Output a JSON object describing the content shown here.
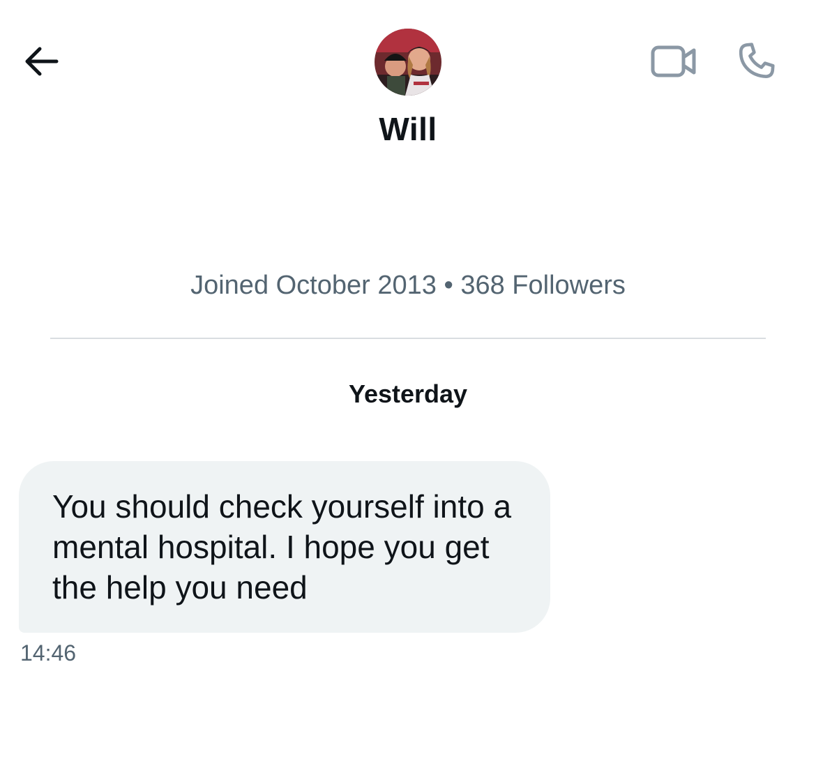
{
  "header": {
    "back_icon": "arrow-left-icon",
    "contact_name": "Will",
    "video_icon": "video-camera-icon",
    "call_icon": "phone-icon"
  },
  "profile": {
    "joined": "Joined October 2013",
    "separator": "•",
    "followers": "368 Followers"
  },
  "conversation": {
    "date_label": "Yesterday",
    "messages": [
      {
        "text": "You should check yourself into a mental hospital. I hope you get the help you need",
        "time": "14:46"
      }
    ]
  },
  "colors": {
    "text_primary": "#0f1419",
    "text_secondary": "#536471",
    "bubble_bg": "#eff3f4",
    "icon_gray": "#8b98a5",
    "divider": "#d9dde1"
  }
}
